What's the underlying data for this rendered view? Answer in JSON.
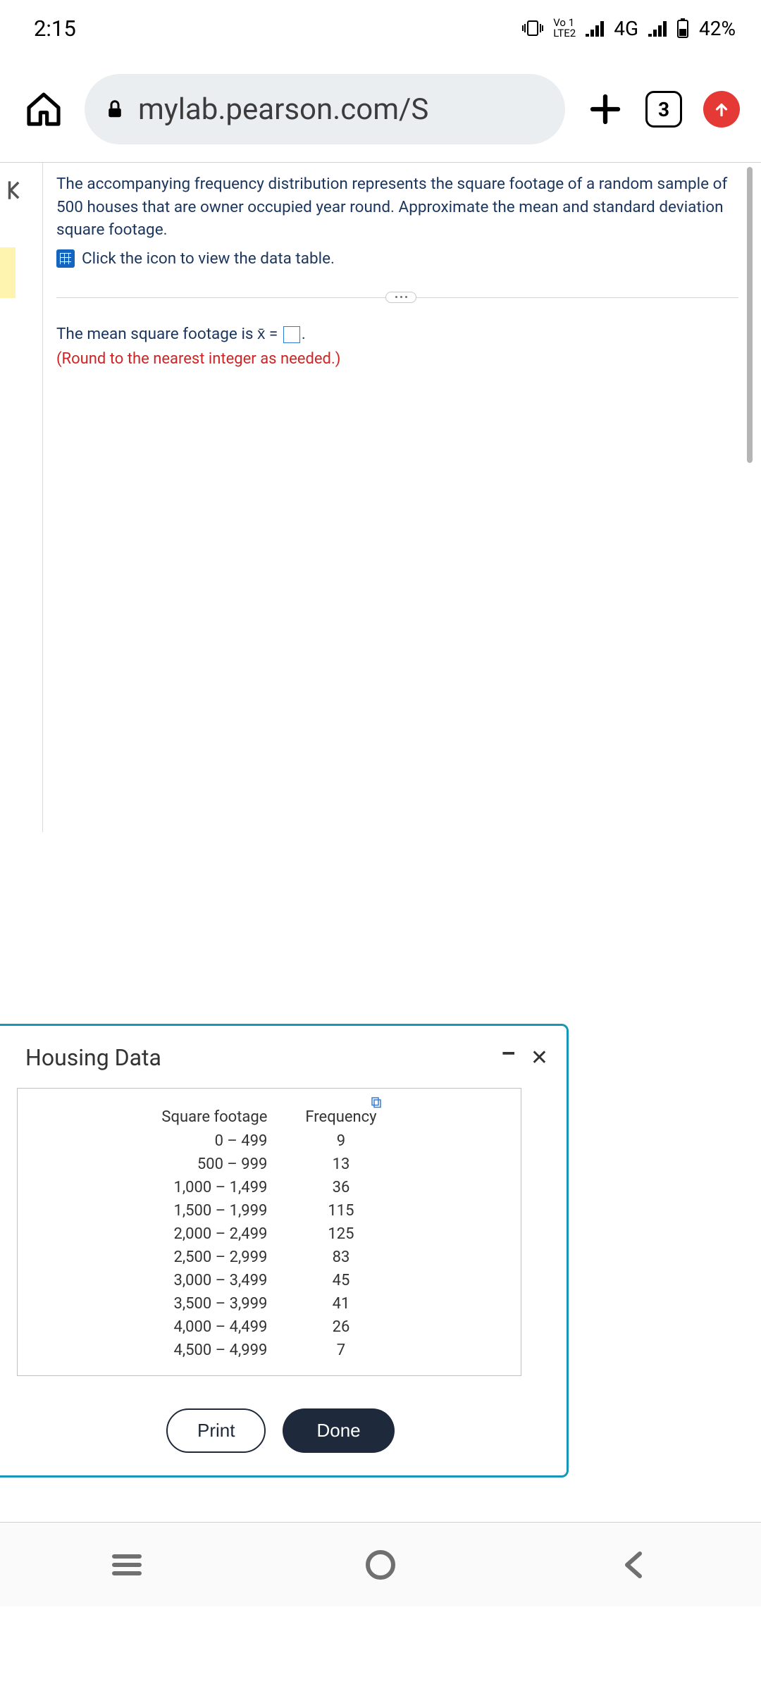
{
  "status": {
    "time": "2:15",
    "lte_top": "Vo 1",
    "lte_bot": "LTE2",
    "net": "4G",
    "battery": "42%"
  },
  "browser": {
    "url": "mylab.pearson.com/S",
    "tab_count": "3"
  },
  "question": {
    "text": "The accompanying frequency distribution represents the square footage of a random sample of 500 houses that are owner occupied year round. Approximate the mean and standard deviation square footage.",
    "data_link": "Click the icon to view the data table."
  },
  "answer": {
    "prefix": "The mean square footage is x̄ = ",
    "suffix": ".",
    "hint": "(Round to the nearest integer as needed.)"
  },
  "popup": {
    "title": "Housing Data",
    "print": "Print",
    "done": "Done",
    "col1": "Square footage",
    "col2": "Frequency",
    "rows": [
      {
        "r": "0 – 499",
        "f": "9"
      },
      {
        "r": "500 – 999",
        "f": "13"
      },
      {
        "r": "1,000 – 1,499",
        "f": "36"
      },
      {
        "r": "1,500 – 1,999",
        "f": "115"
      },
      {
        "r": "2,000 – 2,499",
        "f": "125"
      },
      {
        "r": "2,500 – 2,999",
        "f": "83"
      },
      {
        "r": "3,000 – 3,499",
        "f": "45"
      },
      {
        "r": "3,500 – 3,999",
        "f": "41"
      },
      {
        "r": "4,000 – 4,499",
        "f": "26"
      },
      {
        "r": "4,500 – 4,999",
        "f": "7"
      }
    ]
  },
  "chart_data": {
    "type": "table",
    "title": "Housing Data",
    "columns": [
      "Square footage",
      "Frequency"
    ],
    "categories": [
      "0 – 499",
      "500 – 999",
      "1,000 – 1,499",
      "1,500 – 1,999",
      "2,000 – 2,499",
      "2,500 – 2,999",
      "3,000 – 3,499",
      "3,500 – 3,999",
      "4,000 – 4,499",
      "4,500 – 4,999"
    ],
    "values": [
      9,
      13,
      36,
      115,
      125,
      83,
      45,
      41,
      26,
      7
    ],
    "n": 500
  }
}
